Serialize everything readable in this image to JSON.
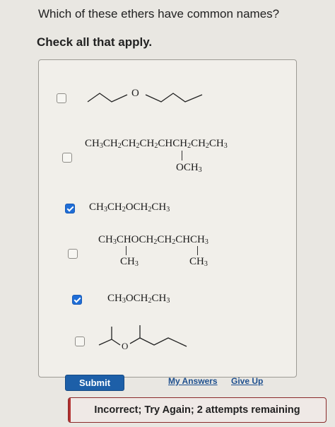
{
  "question": "Which of these ethers have common names?",
  "instruction": "Check all that apply.",
  "options": [
    {
      "checked": false,
      "structure": "skeletal-dipropyl-ether",
      "label_atom": "O"
    },
    {
      "checked": false,
      "main_chain": [
        "CH",
        "3",
        "CH",
        "2",
        "CH",
        "2",
        "CH",
        "2",
        "CHCH",
        "2",
        "CH",
        "2",
        "CH",
        "3"
      ],
      "branch": [
        "OCH",
        "3"
      ]
    },
    {
      "checked": true,
      "formula": [
        "CH",
        "3",
        "CH",
        "2",
        "OCH",
        "2",
        "CH",
        "3"
      ]
    },
    {
      "checked": false,
      "main_chain": [
        "CH",
        "3",
        "CHOCH",
        "2",
        "CH",
        "2",
        "CHCH",
        "3"
      ],
      "branch_left": [
        "CH",
        "3"
      ],
      "branch_right": [
        "CH",
        "3"
      ]
    },
    {
      "checked": true,
      "formula": [
        "CH",
        "3",
        "OCH",
        "2",
        "CH",
        "3"
      ]
    },
    {
      "checked": false,
      "structure": "skeletal-isopropyl-sec-butyl-ether",
      "label_atom": "O"
    }
  ],
  "submit_label": "Submit",
  "my_answers_label": "My Answers",
  "give_up_label": "Give Up",
  "feedback": "Incorrect; Try Again; 2 attempts remaining",
  "colors": {
    "accent": "#1d5fa8",
    "checkbox_checked": "#1f6dd6",
    "error": "#b33030"
  }
}
